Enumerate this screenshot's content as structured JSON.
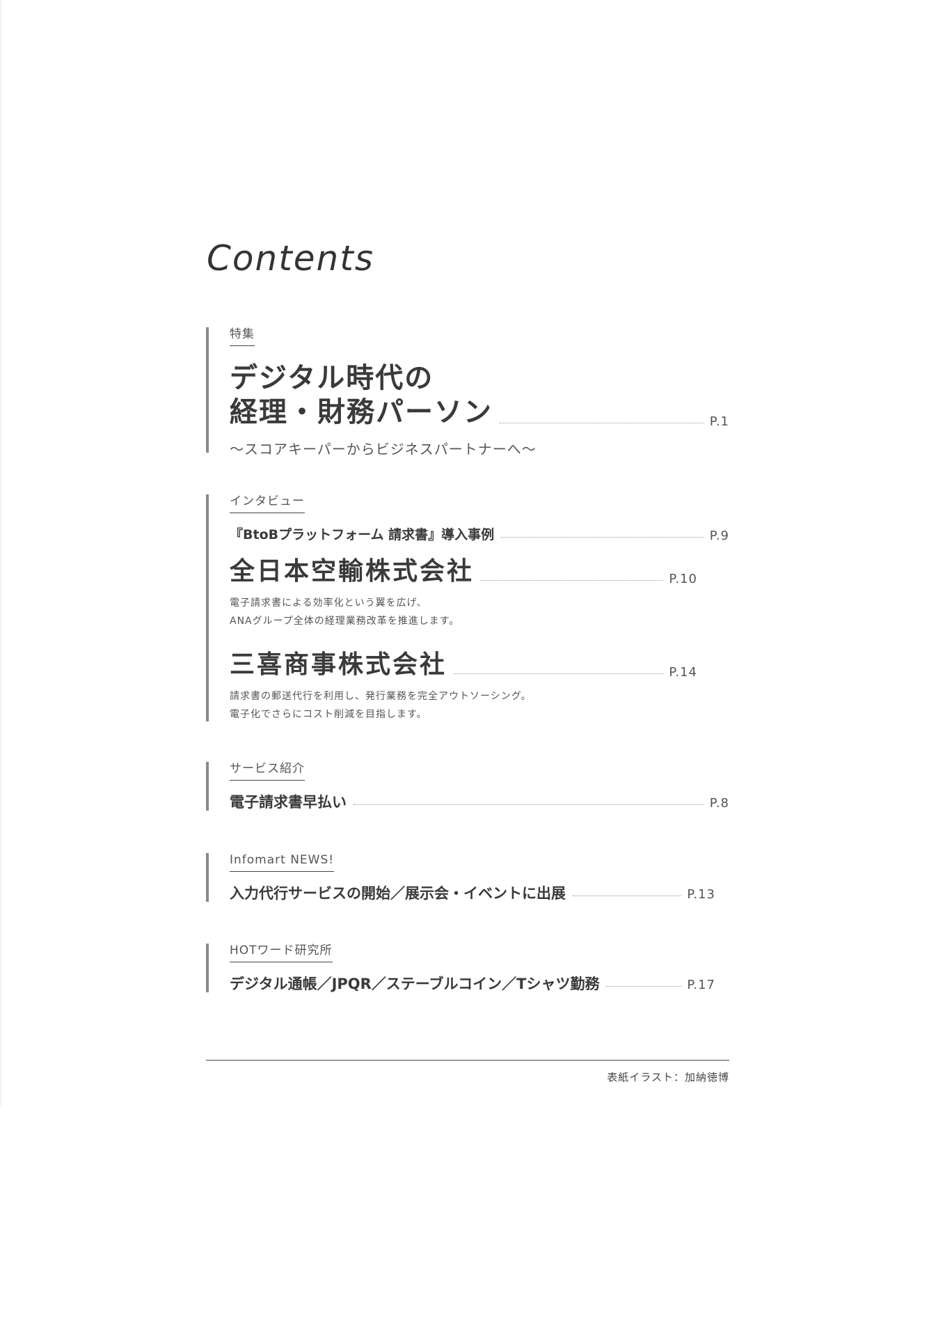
{
  "title": "Contents",
  "feature": {
    "category": "特集",
    "title_line1": "デジタル時代の",
    "title_line2": "経理・財務パーソン",
    "page": "P.1",
    "subtitle": "〜スコアキーパーからビジネスパートナーへ〜"
  },
  "interview": {
    "category": "インタビュー",
    "heading": "『BtoBプラットフォーム 請求書』導入事例",
    "heading_page": "P.9",
    "cases": [
      {
        "company": "全日本空輸株式会社",
        "page": "P.10",
        "desc_line1": "電子請求書による効率化という翼を広げ、",
        "desc_line2": "ANAグループ全体の経理業務改革を推進します。"
      },
      {
        "company": "三喜商事株式会社",
        "page": "P.14",
        "desc_line1": "請求書の郵送代行を利用し、発行業務を完全アウトソーシング。",
        "desc_line2": "電子化でさらにコスト削減を目指します。"
      }
    ]
  },
  "service": {
    "category": "サービス紹介",
    "title": "電子請求書早払い",
    "page": "P.8"
  },
  "news": {
    "category": "Infomart NEWS!",
    "title": "入力代行サービスの開始／展示会・イベントに出展",
    "page": "P.13"
  },
  "hotword": {
    "category": "HOTワード研究所",
    "title": "デジタル通帳／JPQR／ステーブルコイン／Tシャツ勤務",
    "page": "P.17"
  },
  "credit": "表紙イラスト：加納徳博"
}
